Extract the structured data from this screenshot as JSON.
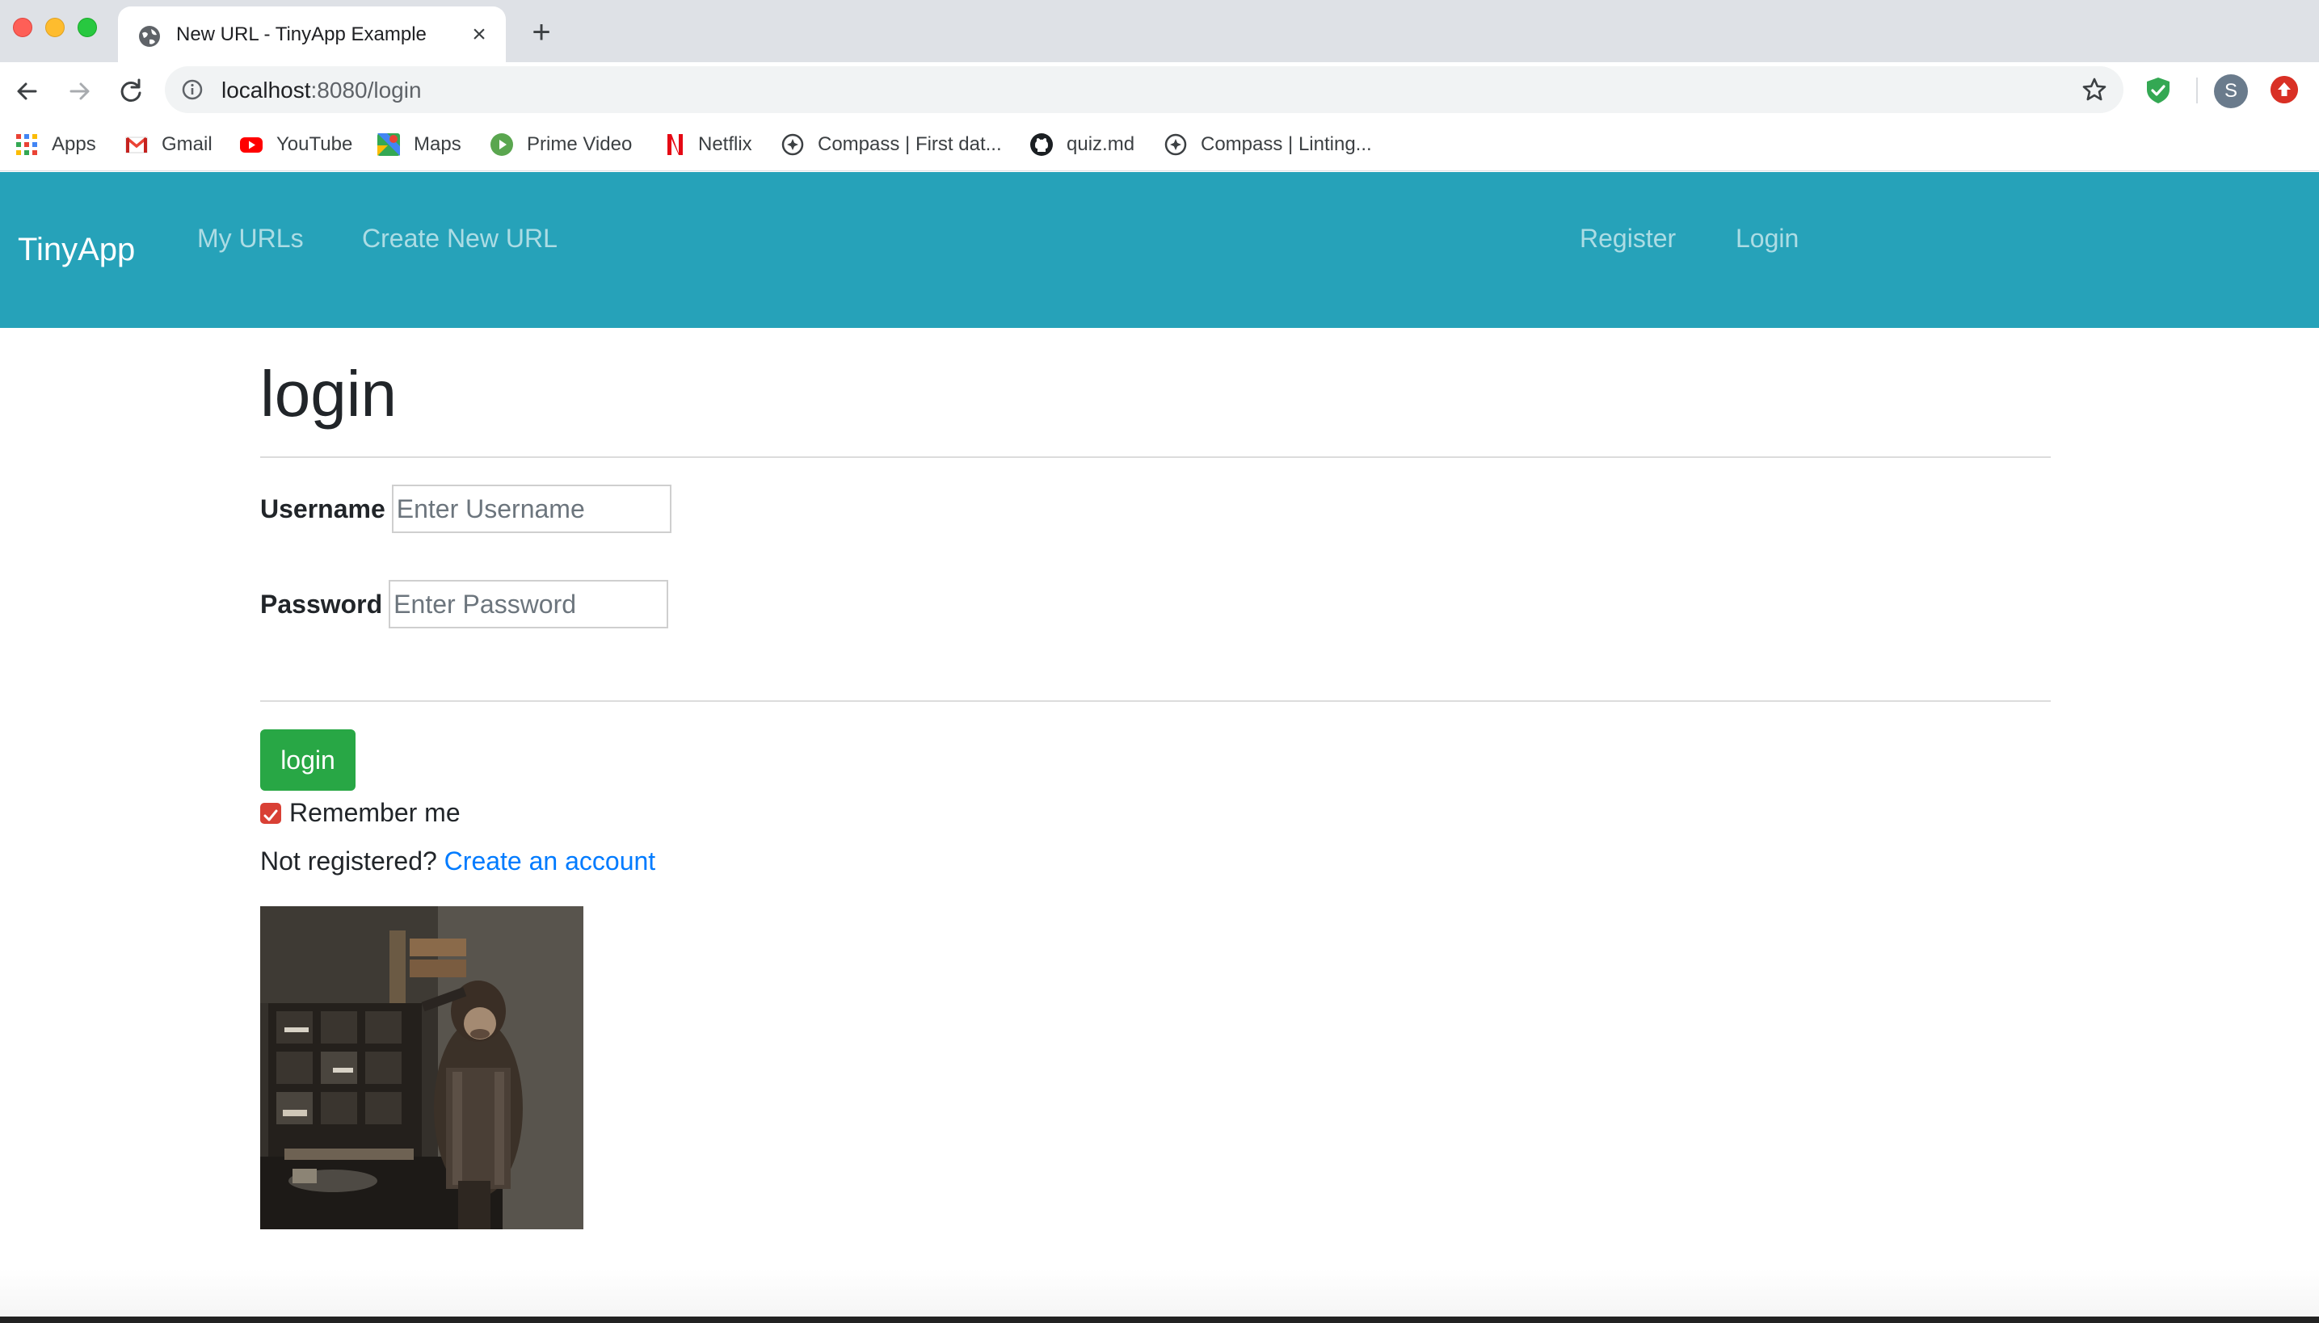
{
  "browser": {
    "tab_title": "New URL - TinyApp Example",
    "url_host": "localhost",
    "url_path": ":8080/login",
    "profile_initial": "S",
    "bookmarks": [
      {
        "label": "Apps",
        "icon": "apps-grid-icon"
      },
      {
        "label": "Gmail",
        "icon": "gmail-icon"
      },
      {
        "label": "YouTube",
        "icon": "youtube-icon"
      },
      {
        "label": "Maps",
        "icon": "maps-icon"
      },
      {
        "label": "Prime Video",
        "icon": "prime-video-icon"
      },
      {
        "label": "Netflix",
        "icon": "netflix-icon"
      },
      {
        "label": "Compass | First dat...",
        "icon": "compass-icon"
      },
      {
        "label": "quiz.md",
        "icon": "github-icon"
      },
      {
        "label": "Compass | Linting...",
        "icon": "compass-icon"
      }
    ]
  },
  "navbar": {
    "brand": "TinyApp",
    "links": [
      "My URLs",
      "Create New URL",
      "Register",
      "Login"
    ],
    "color": "#26a2b9"
  },
  "page": {
    "title": "login",
    "username_label": "Username",
    "username_placeholder": "Enter Username",
    "password_label": "Password",
    "password_placeholder": "Enter Password",
    "login_button": "login",
    "remember_me": "Remember me",
    "remember_checked": true,
    "not_registered": "Not registered?",
    "create_account": "Create an account"
  },
  "colors": {
    "button_green": "#28a745",
    "link_blue": "#007bff",
    "checkbox_red": "#d94035"
  }
}
